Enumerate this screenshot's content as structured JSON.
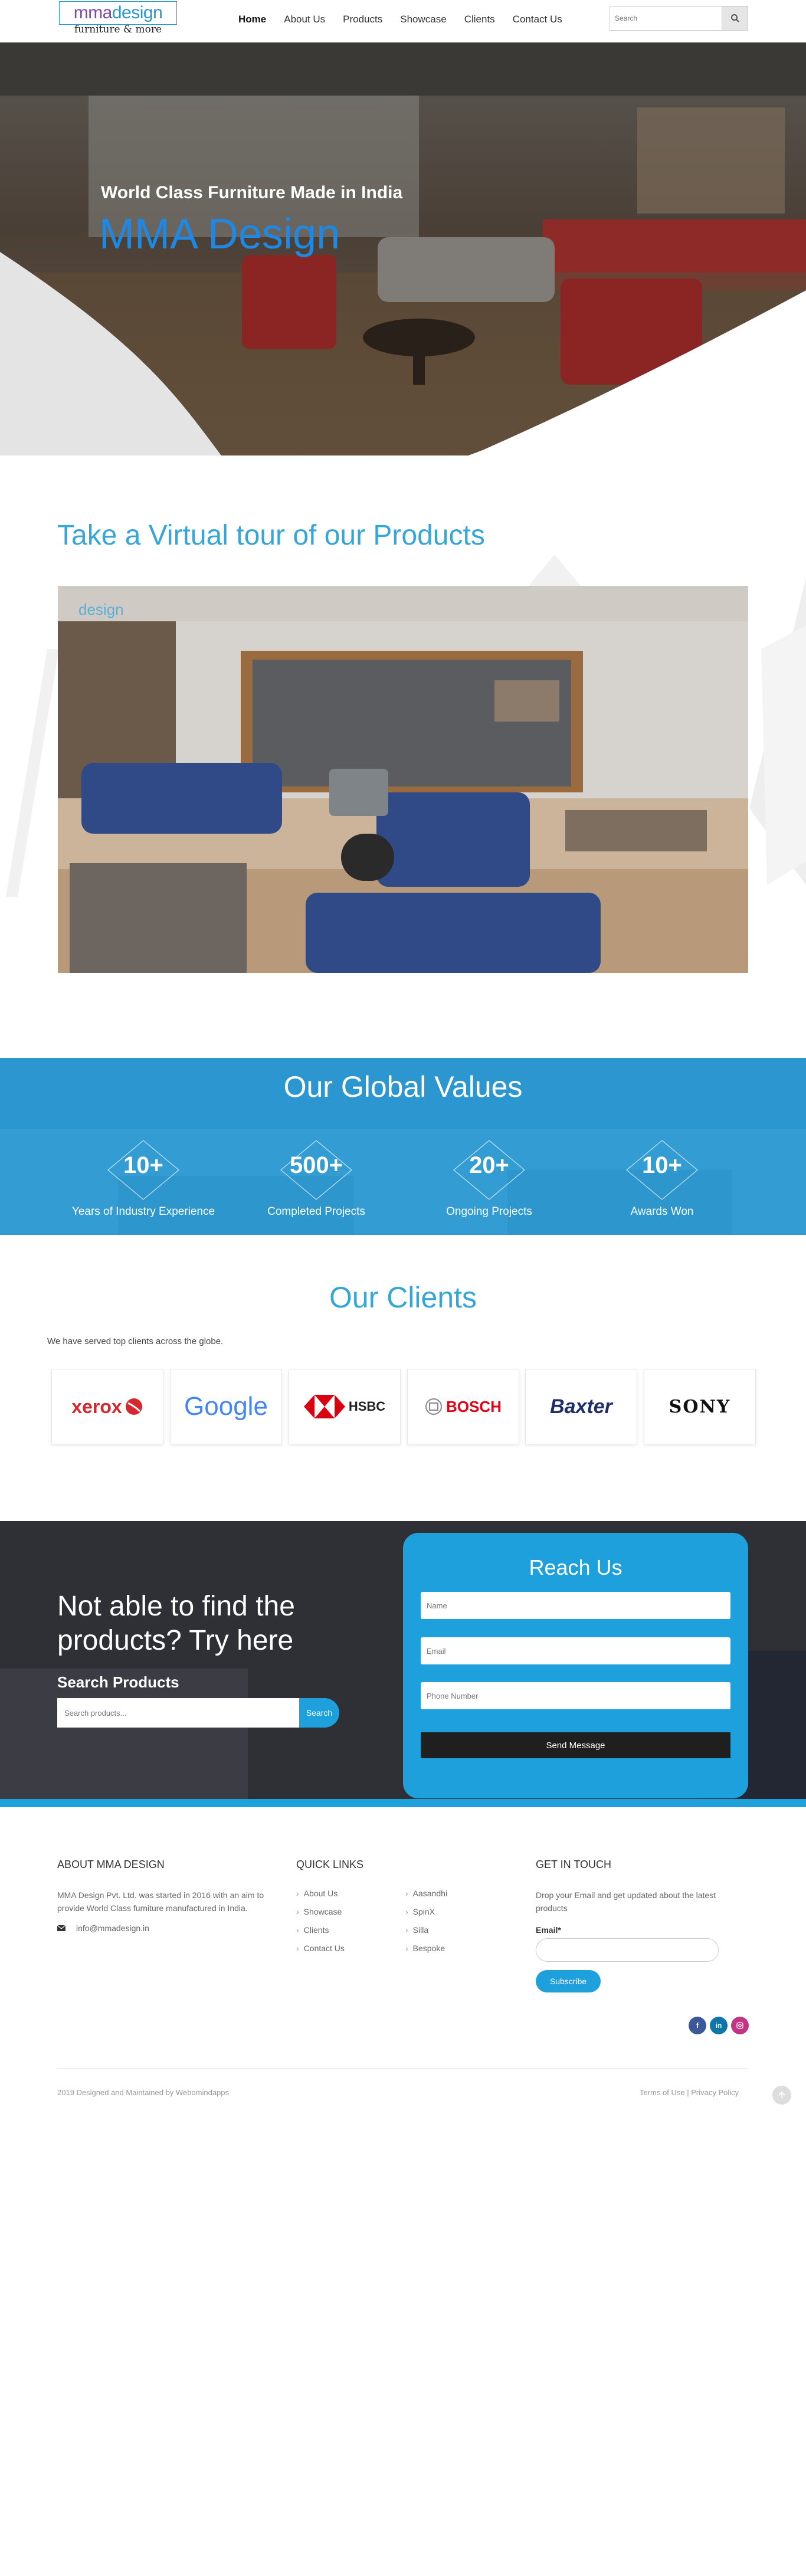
{
  "logo": {
    "brand_prefix": "mma",
    "brand_suffix": "design",
    "tagline": "furniture & more"
  },
  "nav": {
    "items": [
      "Home",
      "About Us",
      "Products",
      "Showcase",
      "Clients",
      "Contact Us"
    ],
    "active": "Home"
  },
  "search": {
    "placeholder": "Search"
  },
  "hero": {
    "subtitle": "World Class Furniture Made in India",
    "title": "MMA Design"
  },
  "tour": {
    "title": "Take a Virtual tour of our Products",
    "watermark_suffix": "design"
  },
  "values": {
    "title": "Our Global Values",
    "items": [
      {
        "number": "10+",
        "label": "Years of Industry Experience"
      },
      {
        "number": "500+",
        "label": "Completed Projects"
      },
      {
        "number": "20+",
        "label": "Ongoing Projects"
      },
      {
        "number": "10+",
        "label": "Awards Won"
      }
    ]
  },
  "clients": {
    "title": "Our Clients",
    "subtitle": "We have served top clients across the globe.",
    "logos": [
      "xerox",
      "Google",
      "HSBC",
      "BOSCH",
      "Baxter",
      "SONY"
    ]
  },
  "find": {
    "title": "Not able to find the products? Try here",
    "search_label": "Search Products",
    "search_placeholder": "Search products...",
    "search_button": "Search"
  },
  "reach": {
    "title": "Reach Us",
    "name_placeholder": "Name",
    "email_placeholder": "Email",
    "phone_placeholder": "Phone Number",
    "send_button": "Send Message"
  },
  "footer": {
    "about": {
      "heading": "ABOUT MMA DESIGN",
      "text": "MMA Design Pvt. Ltd. was started in 2016 with an aim to provide World Class furniture manufactured in India.",
      "email": "info@mmadesign.in"
    },
    "quick_links": {
      "heading": "QUICK LINKS",
      "col1": [
        "About Us",
        "Showcase",
        "Clients",
        "Contact Us"
      ],
      "col2": [
        "Aasandhi",
        "SpinX",
        "Silla",
        "Bespoke"
      ]
    },
    "touch": {
      "heading": "GET IN TOUCH",
      "text": "Drop your Email and get updated about the latest products",
      "email_label": "Email*",
      "subscribe_button": "Subscribe"
    },
    "social_icons": [
      "facebook-icon",
      "linkedin-icon",
      "instagram-icon"
    ],
    "copyright": "2019 Designed and Maintained by Webomindapps",
    "terms": "Terms of Use",
    "privacy": "Privacy Policy",
    "legal_separator": "|"
  },
  "colors": {
    "accent": "#2b96cf",
    "brand_blue": "#1ea0dc",
    "hero_title": "#1e88e5",
    "dark": "#2e3036"
  }
}
